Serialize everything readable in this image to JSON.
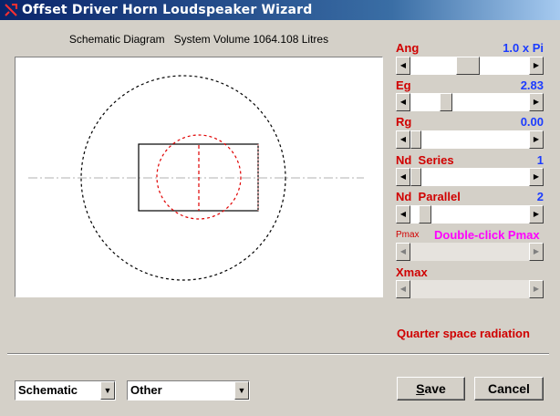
{
  "window": {
    "title": "Offset Driver Horn Loudspeaker Wizard",
    "logo_icon": "speaker-logo-icon"
  },
  "schematic": {
    "caption_left": "Schematic Diagram",
    "caption_right": "System Volume 1064.108 Litres"
  },
  "parameters": {
    "ang": {
      "label": "Ang",
      "value": "1.0 x Pi",
      "slider_fraction": 0.48
    },
    "eg": {
      "label": "Eg",
      "value": "2.83",
      "slider_fraction": 0.28
    },
    "rg": {
      "label": "Rg",
      "value": "0.00",
      "slider_fraction": 0.0
    },
    "nd_series": {
      "label": "Nd  Series",
      "value": "1",
      "slider_fraction": 0.0
    },
    "nd_parallel": {
      "label": "Nd  Parallel",
      "value": "2",
      "slider_fraction": 0.08
    },
    "pmax": {
      "label": "Pmax",
      "hint": "Double-click Pmax"
    },
    "xmax": {
      "label": "Xmax"
    }
  },
  "radiation": "Quarter space radiation",
  "view_select": {
    "value": "Schematic"
  },
  "category_select": {
    "value": "Other"
  },
  "buttons": {
    "save": {
      "accel": "S",
      "rest": "ave"
    },
    "cancel": {
      "label": "Cancel"
    }
  },
  "colors": {
    "label_red": "#d00000",
    "value_blue": "#1c3cff",
    "hint_magenta": "#ff00ff",
    "title_bar": "#0a246a"
  }
}
